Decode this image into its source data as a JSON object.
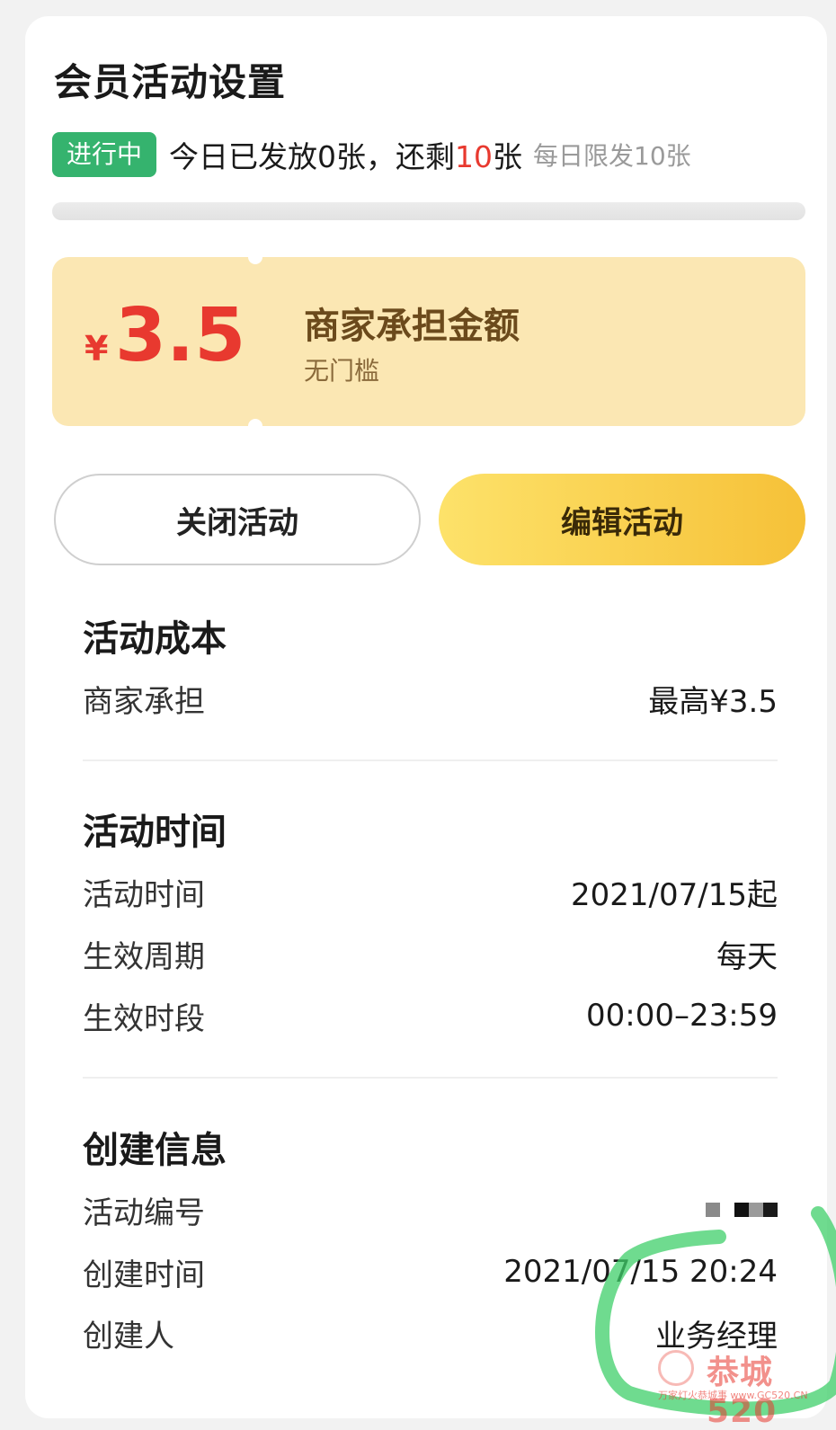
{
  "header": {
    "title": "会员活动设置"
  },
  "status": {
    "badge": "进行中",
    "issued_prefix": "今日已发放0张，还剩",
    "remaining": "10",
    "remaining_suffix": "张",
    "daily_limit": "每日限发10张"
  },
  "coupon": {
    "currency": "¥",
    "amount": "3.5",
    "title": "商家承担金额",
    "subtitle": "无门槛"
  },
  "actions": {
    "close_label": "关闭活动",
    "edit_label": "编辑活动"
  },
  "cost": {
    "title": "活动成本",
    "rows": [
      {
        "label": "商家承担",
        "value": "最高¥3.5"
      }
    ]
  },
  "time": {
    "title": "活动时间",
    "rows": [
      {
        "label": "活动时间",
        "value": "2021/07/15起"
      },
      {
        "label": "生效周期",
        "value": "每天"
      },
      {
        "label": "生效时段",
        "value": "00:00–23:59"
      }
    ]
  },
  "creation": {
    "title": "创建信息",
    "rows": [
      {
        "label": "活动编号",
        "value": ""
      },
      {
        "label": "创建时间",
        "value": "2021/07/15 20:24"
      },
      {
        "label": "创建人",
        "value": "业务经理"
      }
    ]
  },
  "watermark": {
    "text": "恭城520",
    "sub": "万家灯火恭城事 www.GC520.CN"
  },
  "colors": {
    "accent_red": "#e8392f",
    "status_green": "#35b36e",
    "coupon_bg": "#fbe7b3",
    "edit_button": "#f6c138"
  }
}
